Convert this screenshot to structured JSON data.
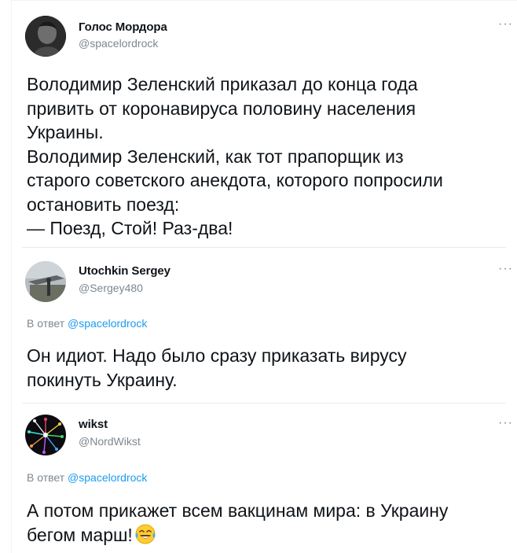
{
  "thread": [
    {
      "author_name": "Голос Мордора",
      "handle": "@spacelordrock",
      "more_label": "···",
      "text": "Володимир Зеленский приказал до конца года\nпривить от коронавируса половину населения\nУкраины.\nВолодимир Зеленский, как тот прапорщик из\nстарого советского анекдота, которого попросили\nостановить поезд:\n— Поезд, Стой! Раз-два!"
    },
    {
      "author_name": "Utochkin Sergey",
      "handle": "@Sergey480",
      "more_label": "···",
      "reply_prefix": "В ответ ",
      "reply_to": "@spacelordrock",
      "text": "Он идиот. Надо было сразу приказать вирусу\nпокинуть Украину."
    },
    {
      "author_name": "wikst",
      "handle": "@NordWikst",
      "more_label": "···",
      "reply_prefix": "В ответ ",
      "reply_to": "@spacelordrock",
      "text": "А потом прикажет всем вакцинам мира: в Украину\nбегом марш!",
      "trailing_emoji": "face-with-tears-of-joy-icon"
    }
  ],
  "colors": {
    "primary_text": "#0f1419",
    "secondary_text": "#7d878f",
    "link": "#1d9bf0",
    "divider": "#e6ecf0"
  }
}
